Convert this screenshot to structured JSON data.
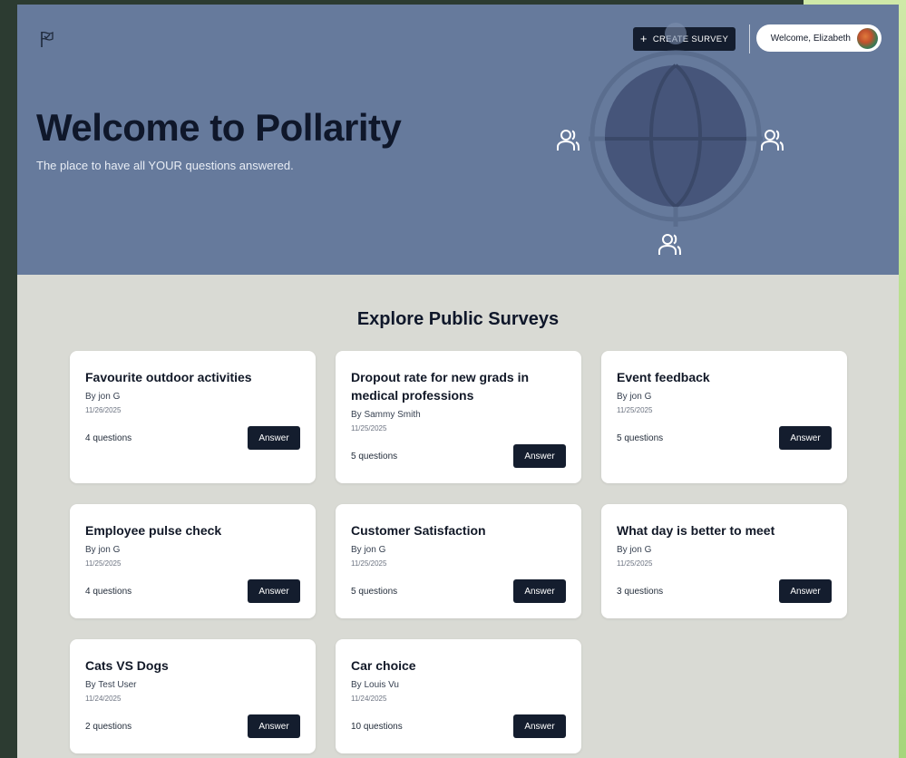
{
  "header": {
    "create_label": "CREATE SURVEY",
    "welcome": "Welcome, Elizabeth"
  },
  "hero": {
    "title": "Welcome to Pollarity",
    "subtitle": "The place to have all YOUR questions answered."
  },
  "section_title": "Explore Public Surveys",
  "answer_label": "Answer",
  "icons": {
    "logo": "flag-check-icon",
    "create": "plus-icon",
    "globe": "globe-icon",
    "users": "users-icon"
  },
  "colors": {
    "hero_bg": "#667a9c",
    "page_bg": "#d9dad4",
    "button_bg": "#141d2e",
    "card_bg": "#ffffff"
  },
  "surveys": [
    {
      "title": "Favourite outdoor activities",
      "author": "By jon G",
      "date": "11/26/2025",
      "questions": "4 questions"
    },
    {
      "title": "Dropout rate for new grads in medical professions",
      "author": "By Sammy Smith",
      "date": "11/25/2025",
      "questions": "5 questions"
    },
    {
      "title": "Event feedback",
      "author": "By jon G",
      "date": "11/25/2025",
      "questions": "5 questions"
    },
    {
      "title": "Employee pulse check",
      "author": "By jon G",
      "date": "11/25/2025",
      "questions": "4 questions"
    },
    {
      "title": "Customer Satisfaction",
      "author": "By jon G",
      "date": "11/25/2025",
      "questions": "5 questions"
    },
    {
      "title": "What day is better to meet",
      "author": "By jon G",
      "date": "11/25/2025",
      "questions": "3 questions"
    },
    {
      "title": "Cats VS Dogs",
      "author": "By Test User",
      "date": "11/24/2025",
      "questions": "2 questions"
    },
    {
      "title": "Car choice",
      "author": "By Louis Vu",
      "date": "11/24/2025",
      "questions": "10 questions"
    }
  ]
}
